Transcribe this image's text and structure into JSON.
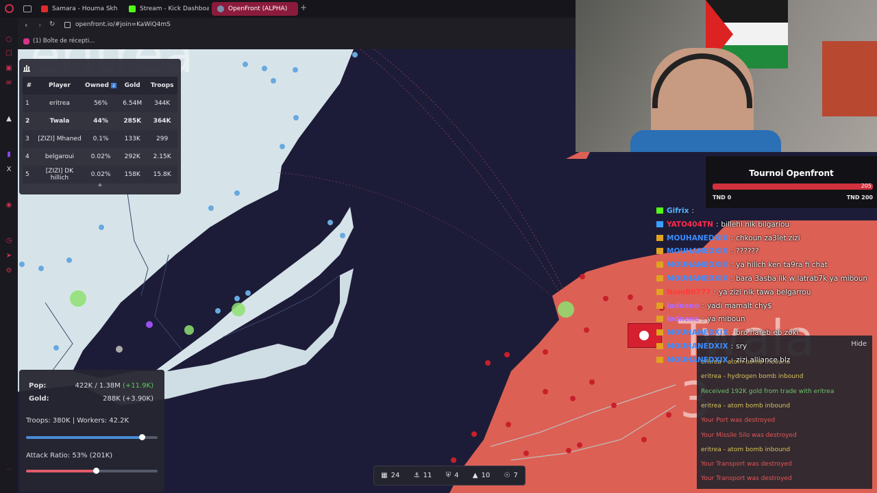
{
  "browser": {
    "tabs": [
      {
        "label": "Samara - Houma Skh",
        "color": "#e02b2b"
      },
      {
        "label": "Stream - Kick Dashboard",
        "color": "#53fc18"
      },
      {
        "label": "OpenFront (ALPHA)",
        "color": "#7a8fa8"
      }
    ],
    "url": "openfront.io/#join=KaWiQ4mS",
    "bookmark": "(1) Boîte de récepti..."
  },
  "map": {
    "country_big_label": "eritrea",
    "twala_label": "Twala",
    "twala_number": "3"
  },
  "leaderboard": {
    "columns": [
      "#",
      "Player",
      "Owned",
      "Gold",
      "Troops"
    ],
    "rows": [
      {
        "rank": "1",
        "player": "eritrea",
        "owned": "56%",
        "gold": "6.54M",
        "troops": "344K"
      },
      {
        "rank": "2",
        "player": "Twala",
        "owned": "44%",
        "gold": "285K",
        "troops": "364K"
      },
      {
        "rank": "3",
        "player": "[ZIZI] Mhaned",
        "owned": "0.1%",
        "gold": "133K",
        "troops": "299"
      },
      {
        "rank": "4",
        "player": "belgaroui",
        "owned": "0.02%",
        "gold": "292K",
        "troops": "2.15K"
      },
      {
        "rank": "5",
        "player": "[ZIZI] DK hillich",
        "owned": "0.02%",
        "gold": "158K",
        "troops": "15.8K"
      }
    ],
    "expand_label": "+"
  },
  "stats": {
    "pop_label": "Pop:",
    "pop_value": "422K / 1.38M",
    "pop_delta": "(+11.9K)",
    "gold_label": "Gold:",
    "gold_value": "288K (+3.90K)",
    "troops_workers": "Troops: 380K | Workers: 42.2K",
    "troop_ratio": 0.88,
    "attack_ratio_label": "Attack Ratio: 53% (201K)",
    "attack_ratio": 0.53
  },
  "buildbar": {
    "city": "24",
    "port": "11",
    "defense": "4",
    "missile": "10",
    "sam": "7"
  },
  "tournament": {
    "title": "Tournoi Openfront",
    "value": "205",
    "min_label": "TND 0",
    "max_label": "TND 200"
  },
  "chat": [
    {
      "user": "Gifrix",
      "sep": ":",
      "text": "",
      "color": "#4fb3ff"
    },
    {
      "user": "YATO404TN",
      "sep": ":",
      "text": "billehi nik bilgariou",
      "color": "#ff2a4a"
    },
    {
      "user": "MOUHANEDXIX",
      "sep": ":",
      "text": "chkoun za3let zizi",
      "color": "#3a8cff"
    },
    {
      "user": "MOUHANEDXIX",
      "sep": ":",
      "text": "??????",
      "color": "#3a8cff"
    },
    {
      "user": "MOUHANEDXIX",
      "sep": ":",
      "text": "ya hilich ken ta9ra fi chat",
      "color": "#3a8cff"
    },
    {
      "user": "MOUHANEDXIX",
      "sep": ":",
      "text": "bara 3asba lik w latrab7k ya miboun",
      "color": "#3a8cff"
    },
    {
      "user": "NumB0777",
      "sep": ":",
      "text": "ya zizi nik tawa belgarrou",
      "color": "#ff3b3b"
    },
    {
      "user": "ladnene",
      "sep": ":",
      "text": "yadi mamalt chy$",
      "color": "#b36bff"
    },
    {
      "user": "ladnene",
      "sep": ":",
      "text": "ya miboun",
      "color": "#b36bff"
    },
    {
      "user": "MOUHANEDXIX",
      "sep": ":",
      "text": "bro hareb eb zoki",
      "color": "#3a8cff"
    },
    {
      "user": "MOUHANEDXIX",
      "sep": ":",
      "text": "sry",
      "color": "#3a8cff"
    },
    {
      "user": "MOUHANEDXIX",
      "sep": ":",
      "text": "zizi alliance blz",
      "color": "#3a8cff"
    }
  ],
  "events": {
    "hide_label": "Hide",
    "items": [
      {
        "text": "eritrea - atom bomb inbound",
        "color": "#d6c35a"
      },
      {
        "text": "eritrea - hydrogen bomb inbound",
        "color": "#d6c35a"
      },
      {
        "text": "Received 192K gold from trade with eritrea",
        "color": "#6cc56c"
      },
      {
        "text": "eritrea - atom bomb inbound",
        "color": "#d6c35a"
      },
      {
        "text": "Your Port was destroyed",
        "color": "#e55555"
      },
      {
        "text": "Your Missile Silo was destroyed",
        "color": "#e55555"
      },
      {
        "text": "eritrea - atom bomb inbound",
        "color": "#d6c35a"
      },
      {
        "text": "Your Transport was destroyed",
        "color": "#e55555"
      },
      {
        "text": "Your Transport was destroyed",
        "color": "#e55555"
      }
    ]
  }
}
